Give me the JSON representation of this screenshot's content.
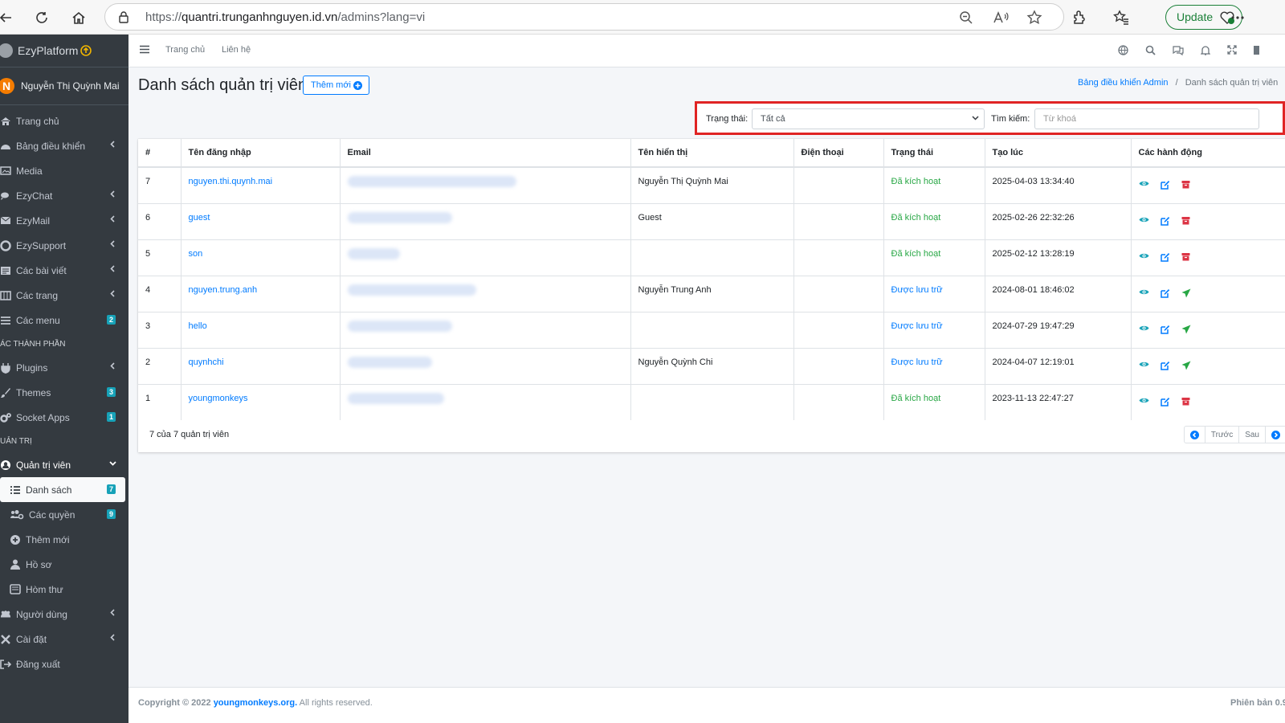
{
  "browser": {
    "url_prefix": "https://",
    "url_host": "quantri.trunganhnguyen.id.vn",
    "url_path": "/admins?lang=vi",
    "update_label": "Update"
  },
  "sidebar": {
    "brand": "EzyPlatform",
    "user_initial": "N",
    "user_name": "Nguyễn Thị Quỳnh Mai",
    "items": [
      {
        "label": "Trang chủ",
        "icon": "home-icon"
      },
      {
        "label": "Bảng điều khiển",
        "icon": "dashboard-icon"
      },
      {
        "label": "Media",
        "icon": "image-icon"
      },
      {
        "label": "EzyChat",
        "icon": "chat-icon"
      },
      {
        "label": "EzyMail",
        "icon": "mail-icon"
      },
      {
        "label": "EzySupport",
        "icon": "support-icon"
      },
      {
        "label": "Các bài viết",
        "icon": "posts-icon"
      },
      {
        "label": "Các trang",
        "icon": "pages-icon"
      },
      {
        "label": "Các menu",
        "icon": "menu-icon",
        "badge": "2"
      },
      {
        "label": "ÁC THÀNH PHẦN"
      },
      {
        "label": "Plugins",
        "icon": "plug-icon"
      },
      {
        "label": "Themes",
        "icon": "brush-icon",
        "badge": "3"
      },
      {
        "label": "Socket Apps",
        "icon": "cogs-icon",
        "badge": "1"
      },
      {
        "label": "UẢN TRỊ"
      },
      {
        "label": "Quản trị viên",
        "icon": "user-circle-icon"
      },
      {
        "label": "Danh sách",
        "icon": "list-icon",
        "badge": "7"
      },
      {
        "label": "Các quyền",
        "icon": "users-cog-icon",
        "badge": "9"
      },
      {
        "label": "Thêm mới",
        "icon": "plus-circle-icon"
      },
      {
        "label": "Hồ sơ",
        "icon": "user-icon"
      },
      {
        "label": "Hòm thư",
        "icon": "inbox-icon"
      },
      {
        "label": "Người dùng",
        "icon": "users-icon"
      },
      {
        "label": "Cài đặt",
        "icon": "tools-icon"
      },
      {
        "label": "Đăng xuất",
        "icon": "sign-out-icon"
      }
    ]
  },
  "topnav": {
    "home": "Trang chủ",
    "contact": "Liên hệ"
  },
  "page": {
    "title": "Danh sách quản trị viên",
    "add_label": "Thêm mới",
    "breadcrumb_home": "Bảng điều khiển Admin",
    "breadcrumb_sep": "/",
    "breadcrumb_current": "Danh sách quản trị viên"
  },
  "filter": {
    "status_label": "Trạng thái:",
    "status_value": "Tất cả",
    "search_label": "Tìm kiếm:",
    "search_placeholder": "Từ khoá"
  },
  "table": {
    "headers": [
      "#",
      "Tên đăng nhập",
      "Email",
      "Tên hiển thị",
      "Điện thoại",
      "Trạng thái",
      "Tạo lúc",
      "Các hành động"
    ],
    "rows": [
      {
        "id": "7",
        "username": "nguyen.thi.quynh.mai",
        "display": "Nguyễn Thị Quỳnh Mai",
        "phone": "",
        "status": "Đã kích hoạt",
        "created": "2025-04-03 13:34:40"
      },
      {
        "id": "6",
        "username": "guest",
        "display": "Guest",
        "phone": "",
        "status": "Đã kích hoạt",
        "created": "2025-02-26 22:32:26"
      },
      {
        "id": "5",
        "username": "son",
        "display": "",
        "phone": "",
        "status": "Đã kích hoạt",
        "created": "2025-02-12 13:28:19"
      },
      {
        "id": "4",
        "username": "nguyen.trung.anh",
        "display": "Nguyễn Trung Anh",
        "phone": "",
        "status": "Được lưu trữ",
        "created": "2024-08-01 18:46:02"
      },
      {
        "id": "3",
        "username": "hello",
        "display": "",
        "phone": "",
        "status": "Được lưu trữ",
        "created": "2024-07-29 19:47:29"
      },
      {
        "id": "2",
        "username": "quynhchi",
        "display": "Nguyễn Quỳnh Chi",
        "phone": "",
        "status": "Được lưu trữ",
        "created": "2024-04-07 12:19:01"
      },
      {
        "id": "1",
        "username": "youngmonkeys",
        "display": "",
        "phone": "",
        "status": "Đã kích hoạt",
        "created": "2023-11-13 22:47:27"
      }
    ],
    "summary": "7 của 7 quản trị viên",
    "prev": "Trước",
    "next": "Sau"
  },
  "footer": {
    "copyright_prefix": "Copyright © 2022 ",
    "copyright_link": "youngmonkeys.org.",
    "copyright_suffix": " All rights reserved.",
    "version": "Phiên bản 0.9"
  },
  "colors": {
    "sidebar_bg": "#343a40",
    "primary": "#007bff",
    "success": "#28a745",
    "danger": "#dc3545",
    "highlight_border": "#e02424"
  }
}
